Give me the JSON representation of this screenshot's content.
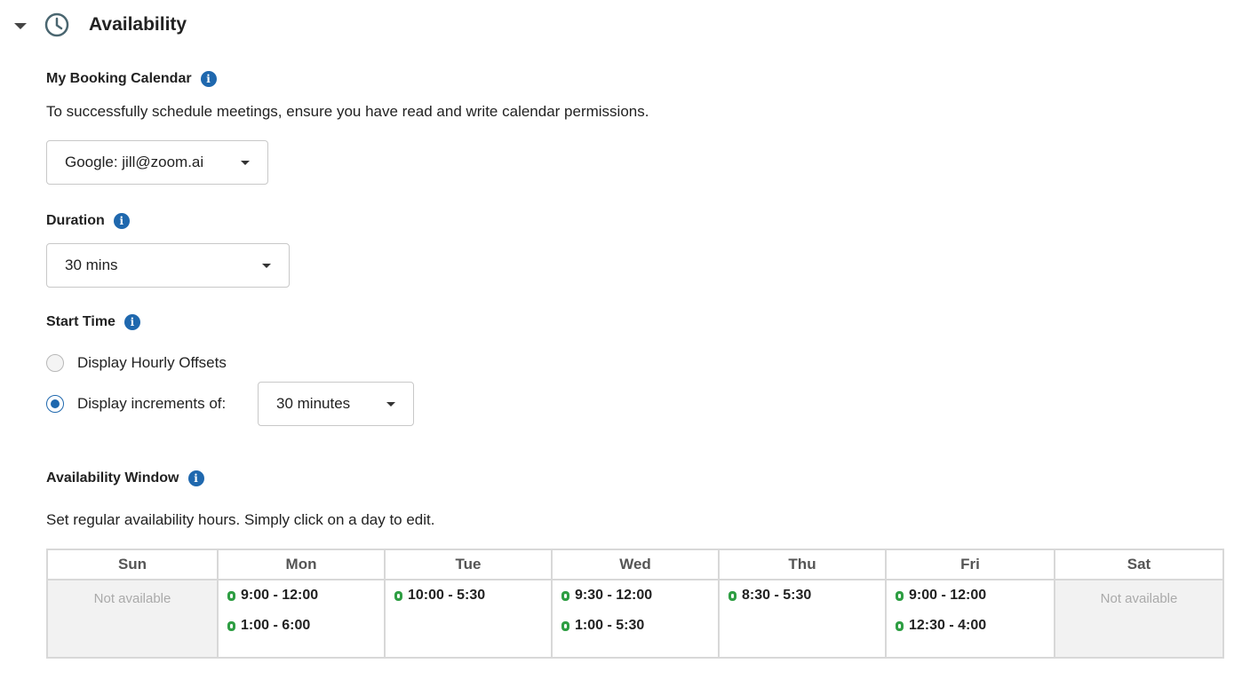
{
  "section": {
    "title": "Availability",
    "icon": "clock-icon",
    "collapse_icon": "caret-down-icon"
  },
  "booking_calendar": {
    "label": "My Booking Calendar",
    "description": "To successfully schedule meetings, ensure you have read and write calendar permissions.",
    "selected": "Google: jill@zoom.ai"
  },
  "duration": {
    "label": "Duration",
    "selected": "30 mins"
  },
  "start_time": {
    "label": "Start Time",
    "option_hourly": "Display Hourly Offsets",
    "option_increments": "Display increments of:",
    "selected_option": "increments",
    "increment_selected": "30 minutes"
  },
  "availability_window": {
    "label": "Availability Window",
    "description": "Set regular availability hours. Simply click on a day to edit.",
    "days": [
      {
        "name": "Sun",
        "available": false,
        "not_available_text": "Not available",
        "slots": []
      },
      {
        "name": "Mon",
        "available": true,
        "slots": [
          "9:00 - 12:00",
          "1:00 - 6:00"
        ]
      },
      {
        "name": "Tue",
        "available": true,
        "slots": [
          "10:00 - 5:30"
        ]
      },
      {
        "name": "Wed",
        "available": true,
        "slots": [
          "9:30 - 12:00",
          "1:00 - 5:30"
        ]
      },
      {
        "name": "Thu",
        "available": true,
        "slots": [
          "8:30 - 5:30"
        ]
      },
      {
        "name": "Fri",
        "available": true,
        "slots": [
          "9:00 - 12:00",
          "12:30 - 4:00"
        ]
      },
      {
        "name": "Sat",
        "available": false,
        "not_available_text": "Not available",
        "slots": []
      }
    ]
  },
  "colors": {
    "accent": "#1f68ae",
    "slot_dot": "#2e9e43",
    "unavailable_bg": "#f2f2f2"
  }
}
